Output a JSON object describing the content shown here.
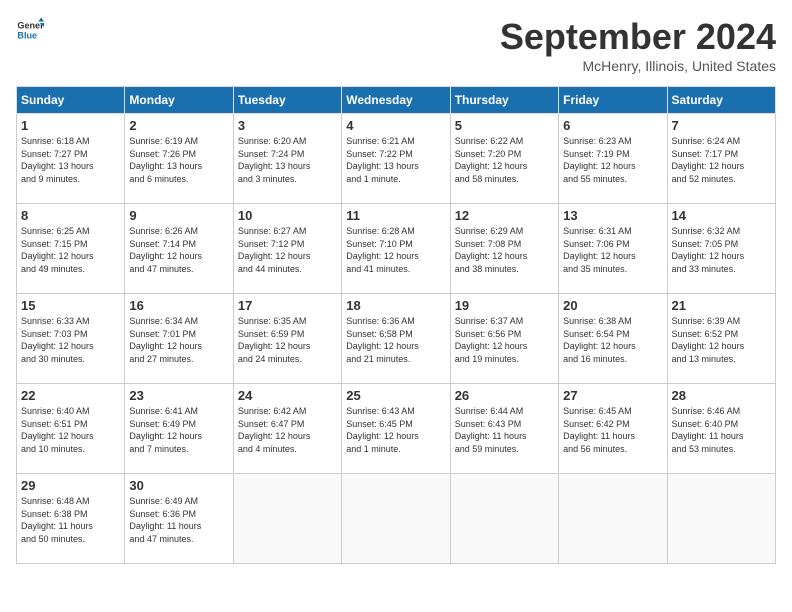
{
  "logo": {
    "line1": "General",
    "line2": "Blue"
  },
  "title": "September 2024",
  "subtitle": "McHenry, Illinois, United States",
  "weekdays": [
    "Sunday",
    "Monday",
    "Tuesday",
    "Wednesday",
    "Thursday",
    "Friday",
    "Saturday"
  ],
  "weeks": [
    [
      {
        "day": "1",
        "info": "Sunrise: 6:18 AM\nSunset: 7:27 PM\nDaylight: 13 hours\nand 9 minutes."
      },
      {
        "day": "2",
        "info": "Sunrise: 6:19 AM\nSunset: 7:26 PM\nDaylight: 13 hours\nand 6 minutes."
      },
      {
        "day": "3",
        "info": "Sunrise: 6:20 AM\nSunset: 7:24 PM\nDaylight: 13 hours\nand 3 minutes."
      },
      {
        "day": "4",
        "info": "Sunrise: 6:21 AM\nSunset: 7:22 PM\nDaylight: 13 hours\nand 1 minute."
      },
      {
        "day": "5",
        "info": "Sunrise: 6:22 AM\nSunset: 7:20 PM\nDaylight: 12 hours\nand 58 minutes."
      },
      {
        "day": "6",
        "info": "Sunrise: 6:23 AM\nSunset: 7:19 PM\nDaylight: 12 hours\nand 55 minutes."
      },
      {
        "day": "7",
        "info": "Sunrise: 6:24 AM\nSunset: 7:17 PM\nDaylight: 12 hours\nand 52 minutes."
      }
    ],
    [
      {
        "day": "8",
        "info": "Sunrise: 6:25 AM\nSunset: 7:15 PM\nDaylight: 12 hours\nand 49 minutes."
      },
      {
        "day": "9",
        "info": "Sunrise: 6:26 AM\nSunset: 7:14 PM\nDaylight: 12 hours\nand 47 minutes."
      },
      {
        "day": "10",
        "info": "Sunrise: 6:27 AM\nSunset: 7:12 PM\nDaylight: 12 hours\nand 44 minutes."
      },
      {
        "day": "11",
        "info": "Sunrise: 6:28 AM\nSunset: 7:10 PM\nDaylight: 12 hours\nand 41 minutes."
      },
      {
        "day": "12",
        "info": "Sunrise: 6:29 AM\nSunset: 7:08 PM\nDaylight: 12 hours\nand 38 minutes."
      },
      {
        "day": "13",
        "info": "Sunrise: 6:31 AM\nSunset: 7:06 PM\nDaylight: 12 hours\nand 35 minutes."
      },
      {
        "day": "14",
        "info": "Sunrise: 6:32 AM\nSunset: 7:05 PM\nDaylight: 12 hours\nand 33 minutes."
      }
    ],
    [
      {
        "day": "15",
        "info": "Sunrise: 6:33 AM\nSunset: 7:03 PM\nDaylight: 12 hours\nand 30 minutes."
      },
      {
        "day": "16",
        "info": "Sunrise: 6:34 AM\nSunset: 7:01 PM\nDaylight: 12 hours\nand 27 minutes."
      },
      {
        "day": "17",
        "info": "Sunrise: 6:35 AM\nSunset: 6:59 PM\nDaylight: 12 hours\nand 24 minutes."
      },
      {
        "day": "18",
        "info": "Sunrise: 6:36 AM\nSunset: 6:58 PM\nDaylight: 12 hours\nand 21 minutes."
      },
      {
        "day": "19",
        "info": "Sunrise: 6:37 AM\nSunset: 6:56 PM\nDaylight: 12 hours\nand 19 minutes."
      },
      {
        "day": "20",
        "info": "Sunrise: 6:38 AM\nSunset: 6:54 PM\nDaylight: 12 hours\nand 16 minutes."
      },
      {
        "day": "21",
        "info": "Sunrise: 6:39 AM\nSunset: 6:52 PM\nDaylight: 12 hours\nand 13 minutes."
      }
    ],
    [
      {
        "day": "22",
        "info": "Sunrise: 6:40 AM\nSunset: 6:51 PM\nDaylight: 12 hours\nand 10 minutes."
      },
      {
        "day": "23",
        "info": "Sunrise: 6:41 AM\nSunset: 6:49 PM\nDaylight: 12 hours\nand 7 minutes."
      },
      {
        "day": "24",
        "info": "Sunrise: 6:42 AM\nSunset: 6:47 PM\nDaylight: 12 hours\nand 4 minutes."
      },
      {
        "day": "25",
        "info": "Sunrise: 6:43 AM\nSunset: 6:45 PM\nDaylight: 12 hours\nand 1 minute."
      },
      {
        "day": "26",
        "info": "Sunrise: 6:44 AM\nSunset: 6:43 PM\nDaylight: 11 hours\nand 59 minutes."
      },
      {
        "day": "27",
        "info": "Sunrise: 6:45 AM\nSunset: 6:42 PM\nDaylight: 11 hours\nand 56 minutes."
      },
      {
        "day": "28",
        "info": "Sunrise: 6:46 AM\nSunset: 6:40 PM\nDaylight: 11 hours\nand 53 minutes."
      }
    ],
    [
      {
        "day": "29",
        "info": "Sunrise: 6:48 AM\nSunset: 6:38 PM\nDaylight: 11 hours\nand 50 minutes."
      },
      {
        "day": "30",
        "info": "Sunrise: 6:49 AM\nSunset: 6:36 PM\nDaylight: 11 hours\nand 47 minutes."
      },
      {
        "day": "",
        "info": ""
      },
      {
        "day": "",
        "info": ""
      },
      {
        "day": "",
        "info": ""
      },
      {
        "day": "",
        "info": ""
      },
      {
        "day": "",
        "info": ""
      }
    ]
  ]
}
